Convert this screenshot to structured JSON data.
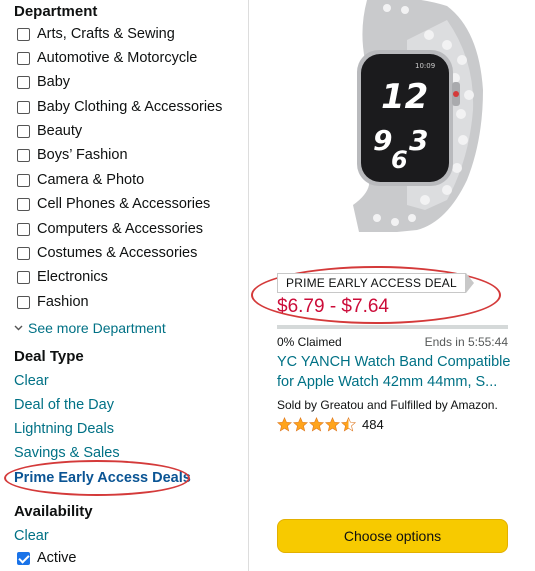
{
  "sidebar": {
    "department_title": "Department",
    "departments": [
      "Arts, Crafts & Sewing",
      "Automotive & Motorcycle",
      "Baby",
      "Baby Clothing & Accessories",
      "Beauty",
      "Boys’ Fashion",
      "Camera & Photo",
      "Cell Phones & Accessories",
      "Computers & Accessories",
      "Costumes & Accessories",
      "Electronics",
      "Fashion"
    ],
    "see_more": "See more Department",
    "deal_type_title": "Deal Type",
    "deal_types": [
      "Clear",
      "Deal of the Day",
      "Lightning Deals",
      "Savings & Sales",
      "Prime Early Access Deals"
    ],
    "availability_title": "Availability",
    "availability_clear": "Clear",
    "availability_active": "Active",
    "highlight_color": "#d43a3a"
  },
  "product": {
    "image_icon": "apple-watch-band-image",
    "watch_time_top": "12",
    "watch_time_bottom": "9 6 3",
    "badge": "PRIME EARLY ACCESS DEAL",
    "price": "$6.79 - $7.64",
    "claimed_fraction": 0.0,
    "claimed": "0% Claimed",
    "ends": "Ends in 5:55:44",
    "title_line1": "YC YANCH Watch Band Compatible",
    "title_line2": "for Apple Watch 42mm 44mm, S...",
    "seller": "Sold by Greatou and Fulfilled by Amazon.",
    "rating": 4.5,
    "rating_count": "484",
    "button": "Choose options",
    "price_color": "#CC0C39",
    "button_color": "#F7CA00"
  }
}
